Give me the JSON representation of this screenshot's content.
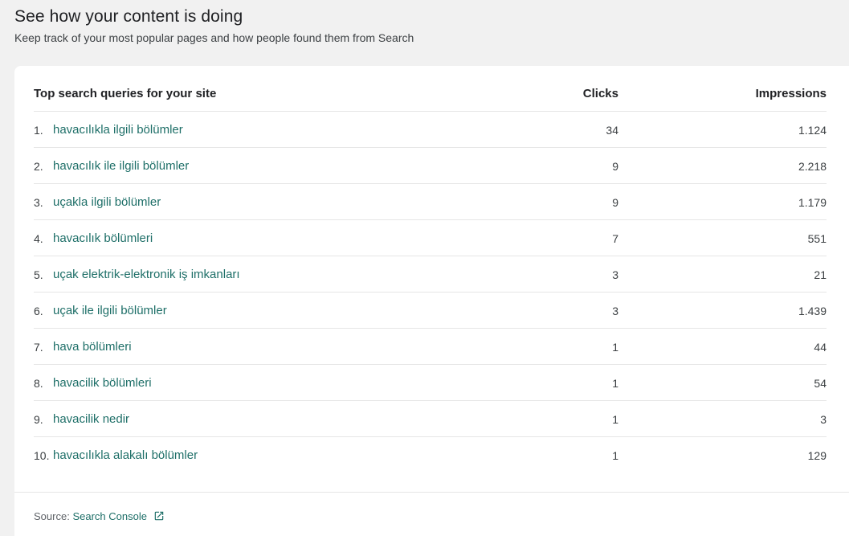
{
  "header": {
    "title": "See how your content is doing",
    "subtitle": "Keep track of your most popular pages and how people found them from Search"
  },
  "table": {
    "col_query": "Top search queries for your site",
    "col_clicks": "Clicks",
    "col_impressions": "Impressions",
    "rows": [
      {
        "rank": "1.",
        "query": "havacılıkla ilgili bölümler",
        "clicks": "34",
        "impressions": "1.124"
      },
      {
        "rank": "2.",
        "query": "havacılık ile ilgili bölümler",
        "clicks": "9",
        "impressions": "2.218"
      },
      {
        "rank": "3.",
        "query": "uçakla ilgili bölümler",
        "clicks": "9",
        "impressions": "1.179"
      },
      {
        "rank": "4.",
        "query": "havacılık bölümleri",
        "clicks": "7",
        "impressions": "551"
      },
      {
        "rank": "5.",
        "query": "uçak elektrik-elektronik iş imkanları",
        "clicks": "3",
        "impressions": "21"
      },
      {
        "rank": "6.",
        "query": "uçak ile ilgili bölümler",
        "clicks": "3",
        "impressions": "1.439"
      },
      {
        "rank": "7.",
        "query": "hava bölümleri",
        "clicks": "1",
        "impressions": "44"
      },
      {
        "rank": "8.",
        "query": "havacilik bölümleri",
        "clicks": "1",
        "impressions": "54"
      },
      {
        "rank": "9.",
        "query": "havacilik nedir",
        "clicks": "1",
        "impressions": "3"
      },
      {
        "rank": "10.",
        "query": "havacılıkla alakalı bölümler",
        "clicks": "1",
        "impressions": "129"
      }
    ]
  },
  "footer": {
    "source_label": "Source:",
    "source_link": "Search Console",
    "link_icon": "external-link-icon"
  },
  "colors": {
    "link": "#1e6f68",
    "background": "#f1f1f1"
  }
}
